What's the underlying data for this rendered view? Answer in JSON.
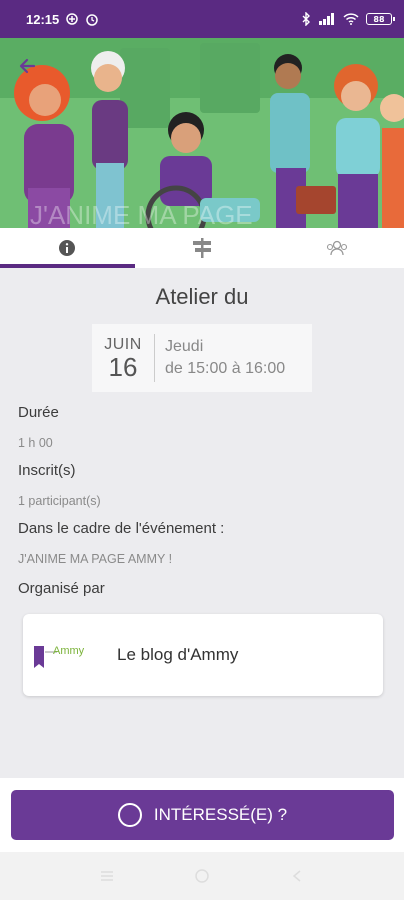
{
  "status_bar": {
    "time": "12:15",
    "battery": "88",
    "icons": [
      "notification-icon",
      "alarm-icon",
      "bluetooth-icon",
      "signal-icon",
      "wifi-icon",
      "battery-icon"
    ]
  },
  "hero": {
    "overlay_text": "J'ANIME MA PAGE"
  },
  "tabs": [
    {
      "name": "info",
      "icon": "info-icon",
      "active": true
    },
    {
      "name": "signpost",
      "icon": "signpost-icon",
      "active": false
    },
    {
      "name": "participants",
      "icon": "group-icon",
      "active": false
    }
  ],
  "event": {
    "title": "Atelier du",
    "date_month": "JUIN",
    "date_day": "16",
    "weekday": "Jeudi",
    "time_range": "de 15:00 à 16:00"
  },
  "details": {
    "duration_label": "Durée",
    "duration_value": "1 h 00",
    "registered_label": "Inscrit(s)",
    "registered_value": "1 participant(s)",
    "context_label": "Dans le cadre de l'événement :",
    "context_value": "J'ANIME MA PAGE AMMY !",
    "organizer_label": "Organisé par"
  },
  "organizer": {
    "name": "Le blog d'Ammy",
    "logo_text": "Ammy"
  },
  "action": {
    "interest_label": "INTÉRESSÉ(E) ?"
  },
  "colors": {
    "brand_purple": "#5a2a82",
    "button_purple": "#6a3a96",
    "background": "#ececef"
  }
}
